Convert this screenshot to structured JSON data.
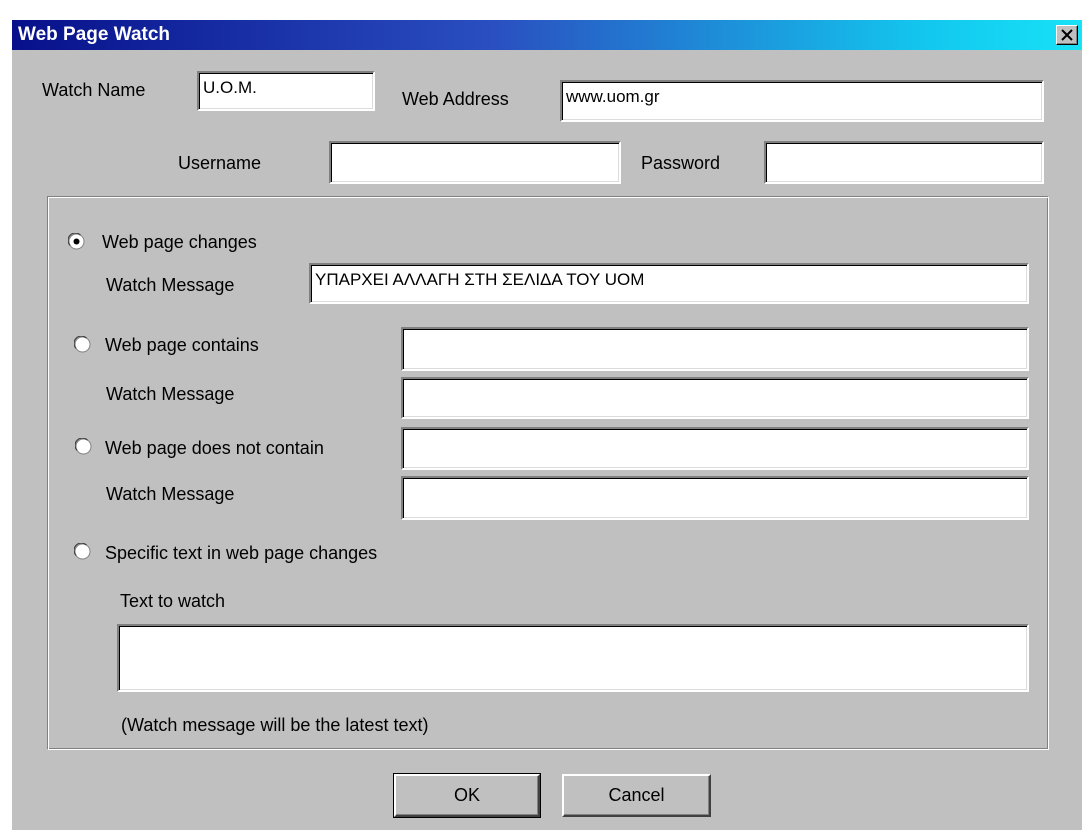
{
  "window": {
    "title": "Web Page Watch"
  },
  "fields": {
    "watch_name_label": "Watch Name",
    "watch_name_value": "U.O.M.",
    "web_address_label": "Web Address",
    "web_address_value": "www.uom.gr",
    "username_label": "Username",
    "username_value": "",
    "password_label": "Password",
    "password_value": ""
  },
  "options": {
    "changes": {
      "label": "Web page changes",
      "selected": true,
      "message_label": "Watch Message",
      "message_value": "ΥΠΑΡΧΕΙ ΑΛΛΑΓΗ ΣΤΗ ΣΕΛΙΔΑ ΤΟΥ UOM"
    },
    "contains": {
      "label": "Web page contains",
      "selected": false,
      "text_value": "",
      "message_label": "Watch Message",
      "message_value": ""
    },
    "not_contains": {
      "label": "Web page does not contain",
      "selected": false,
      "text_value": "",
      "message_label": "Watch Message",
      "message_value": ""
    },
    "specific": {
      "label": "Specific text in web page changes",
      "selected": false,
      "text_label": "Text to watch",
      "text_value": "",
      "note": "(Watch message will be the latest text)"
    }
  },
  "buttons": {
    "ok": "OK",
    "cancel": "Cancel"
  },
  "icons": {
    "close": "close-icon",
    "radio_selected": "radio-selected-icon",
    "radio_unselected": "radio-unselected-icon"
  }
}
